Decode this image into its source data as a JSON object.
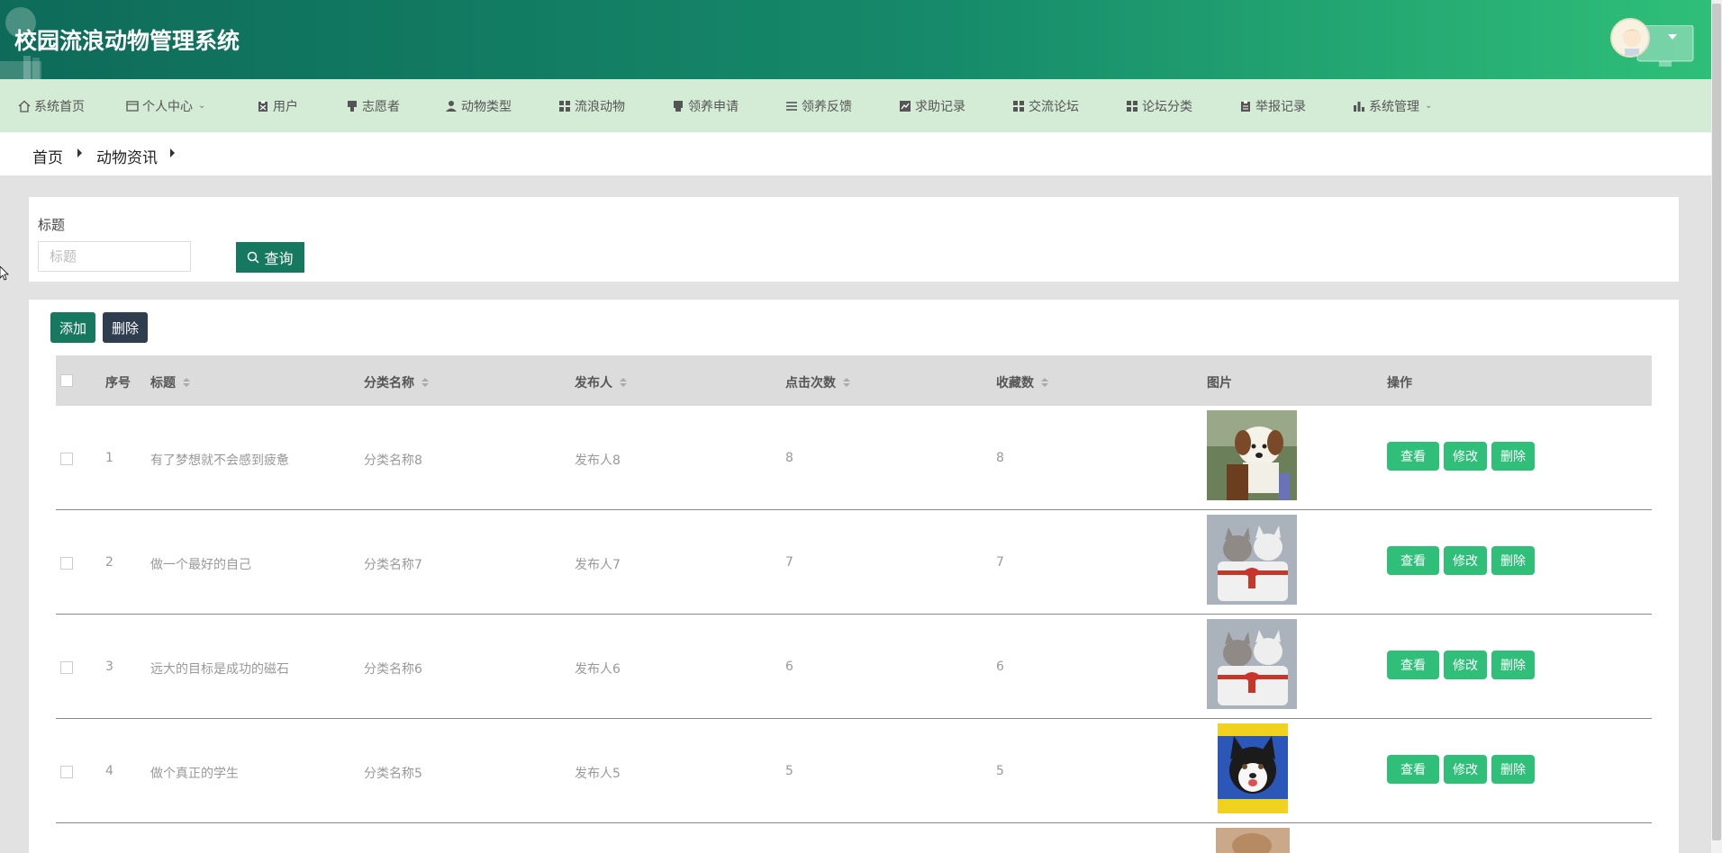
{
  "header": {
    "title": "校园流浪动物管理系统"
  },
  "nav": [
    {
      "label": "系统首页",
      "icon": "home-icon"
    },
    {
      "label": "个人中心",
      "icon": "id-card-icon",
      "dropdown": true
    },
    {
      "label": "用户",
      "icon": "clipboard-icon"
    },
    {
      "label": "志愿者",
      "icon": "stamp-icon"
    },
    {
      "label": "动物类型",
      "icon": "person-icon"
    },
    {
      "label": "流浪动物",
      "icon": "grid-icon"
    },
    {
      "label": "领养申请",
      "icon": "tray-icon"
    },
    {
      "label": "领养反馈",
      "icon": "list-icon"
    },
    {
      "label": "求助记录",
      "icon": "chart-icon"
    },
    {
      "label": "交流论坛",
      "icon": "grid-icon"
    },
    {
      "label": "论坛分类",
      "icon": "grid-icon"
    },
    {
      "label": "举报记录",
      "icon": "clipboard-icon"
    },
    {
      "label": "系统管理",
      "icon": "bar-chart-icon",
      "dropdown": true
    }
  ],
  "breadcrumb": [
    "首页",
    "动物资讯"
  ],
  "search": {
    "label": "标题",
    "placeholder": "标题",
    "button": "查询"
  },
  "toolbar": {
    "add": "添加",
    "delete": "删除"
  },
  "table": {
    "columns": [
      "序号",
      "标题",
      "分类名称",
      "发布人",
      "点击次数",
      "收藏数",
      "图片",
      "操作"
    ],
    "rows": [
      {
        "no": "1",
        "title": "有了梦想就不会感到疲惫",
        "category": "分类名称8",
        "publisher": "发布人8",
        "clicks": "8",
        "favorites": "8",
        "image": "puppy-photo"
      },
      {
        "no": "2",
        "title": "做一个最好的自己",
        "category": "分类名称7",
        "publisher": "发布人7",
        "clicks": "7",
        "favorites": "7",
        "image": "kittens-basket-photo"
      },
      {
        "no": "3",
        "title": "远大的目标是成功的磁石",
        "category": "分类名称6",
        "publisher": "发布人6",
        "clicks": "6",
        "favorites": "6",
        "image": "kittens-basket-photo"
      },
      {
        "no": "4",
        "title": "做个真正的学生",
        "category": "分类名称5",
        "publisher": "发布人5",
        "clicks": "5",
        "favorites": "5",
        "image": "husky-puppy-photo"
      }
    ],
    "actions": {
      "view": "查看",
      "edit": "修改",
      "delete": "删除"
    }
  },
  "colors": {
    "header_start": "#0e6b59",
    "header_end": "#2fbf79",
    "nav_bg": "#d4ecd6",
    "primary": "#16785f",
    "action": "#2fbf79",
    "dark": "#2e3e4f"
  }
}
